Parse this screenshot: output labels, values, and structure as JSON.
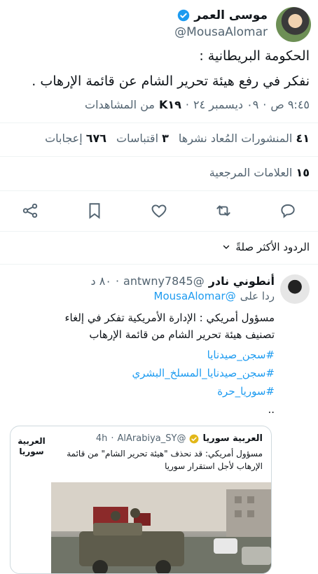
{
  "author": {
    "name": "موسى العمر",
    "handle": "@MousaAlomar"
  },
  "tweet": {
    "line1": "الحكومة البريطانية :",
    "line2": "نفكر في رفع هيئة تحرير الشام عن قائمة الإرهاب ."
  },
  "meta": {
    "time": "٩:٤٥ ص",
    "date": "٠٩ ديسمبر ٢٤",
    "views_count": "K١٩",
    "views_label": "من المشاهدات",
    "sep": "·"
  },
  "stats": {
    "reposts_count": "٤١",
    "reposts_label": "المنشورات المُعاد نشرها",
    "quotes_count": "٣",
    "quotes_label": "اقتباسات",
    "likes_count": "٦٧٦",
    "likes_label": "إعجابات",
    "bookmarks_count": "١٥",
    "bookmarks_label": "العلامات المرجعية"
  },
  "actions": [
    "reply-icon",
    "repost-icon",
    "like-icon",
    "bookmark-icon",
    "share-icon"
  ],
  "replies_header": {
    "label": "الردود الأكثر صلةً"
  },
  "reply": {
    "name": "أنطوني نادر",
    "handle": "@antwny7845",
    "time": "٨٠ د",
    "replying_to_label": "ردا على",
    "replying_to_handle": "@MousaAlomar",
    "text_line1": "مسؤول أمريكي : الإدارة الأمريكية تفكر في إلغاء",
    "text_line2": "تصنيف هيئة تحرير الشام من قائمة الإرهاب",
    "hashtags": [
      "#سجن_صيدنايا",
      "#سجن_صيدنايا_المسلخ_البشري",
      "#سوريا_حرة"
    ],
    "ellipsis": ".."
  },
  "quote": {
    "name": "العربية سوريا",
    "handle": "@AlArabiya_SY",
    "time": "4h",
    "logo_line1": "العربية",
    "logo_line2": "سوريا",
    "text_line1": "مسؤول أمريكي: قد نحذف \"هيئة تحرير الشام\" من قائمة",
    "text_line2": "الإرهاب لأجل استقرار سوريا"
  },
  "colors": {
    "accent": "#1d9bf0",
    "text": "#0f1419",
    "muted": "#536471",
    "verified_gold": "#e2b719"
  }
}
